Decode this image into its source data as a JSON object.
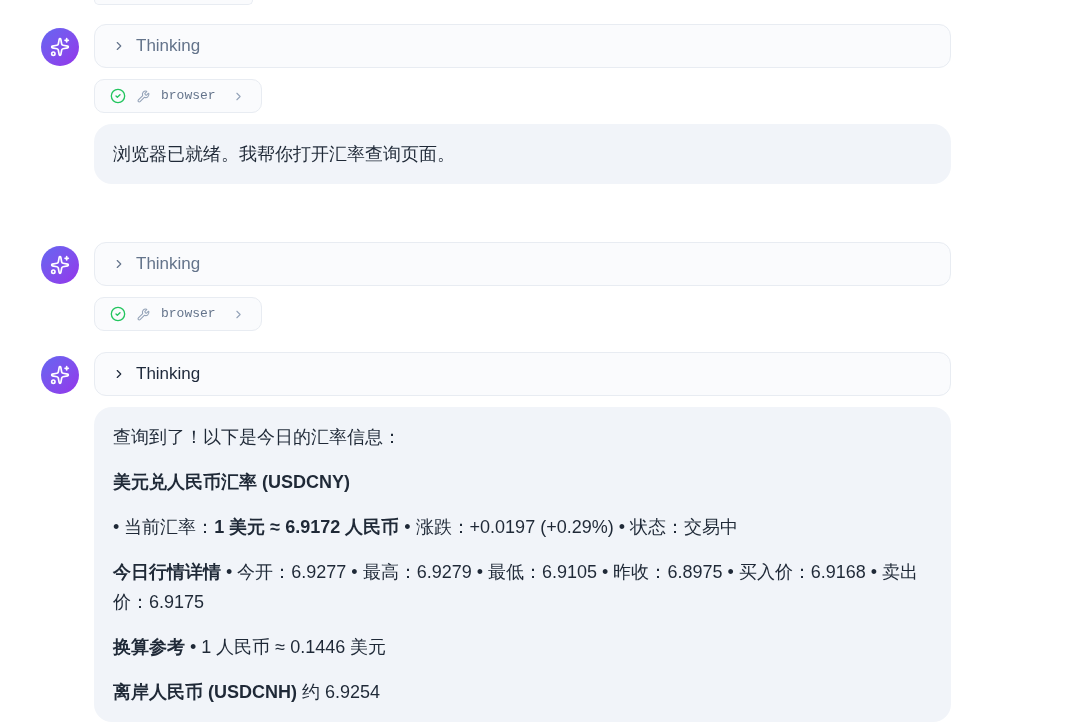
{
  "groups": [
    {
      "items": [
        {
          "kind": "thinking",
          "label": "Thinking",
          "expanded": false,
          "active": false
        },
        {
          "kind": "tool",
          "done": true,
          "name": "browser"
        },
        {
          "kind": "reply",
          "paragraphs": [
            {
              "kind": "text",
              "text": "浏览器已就绪。我帮你打开汇率查询页面。"
            }
          ]
        }
      ]
    },
    {
      "items": [
        {
          "kind": "thinking",
          "label": "Thinking",
          "expanded": false,
          "active": false
        },
        {
          "kind": "tool",
          "done": true,
          "name": "browser"
        }
      ]
    },
    {
      "items": [
        {
          "kind": "thinking",
          "label": "Thinking",
          "expanded": false,
          "active": true
        },
        {
          "kind": "reply",
          "paragraphs": [
            {
              "kind": "text",
              "text": "查询到了！以下是今日的汇率信息："
            },
            {
              "kind": "heading",
              "text": "美元兑人民币汇率 (USDCNY)"
            },
            {
              "kind": "text",
              "text": "• 当前汇率：**1 美元 ≈ 6.9172 人民币** • 涨跌：+0.0197 (+0.29%) • 状态：交易中"
            },
            {
              "kind": "text",
              "text": "**今日行情详情** • 今开：6.9277 • 最高：6.9279 • 最低：6.9105 • 昨收：6.8975 • 买入价：6.9168 • 卖出价：6.9175"
            },
            {
              "kind": "text",
              "text": "**换算参考** • 1 人民币 ≈ 0.1446 美元"
            },
            {
              "kind": "text",
              "text": "**离岸人民币 (USDCNH)** 约 6.9254"
            }
          ]
        }
      ]
    }
  ]
}
